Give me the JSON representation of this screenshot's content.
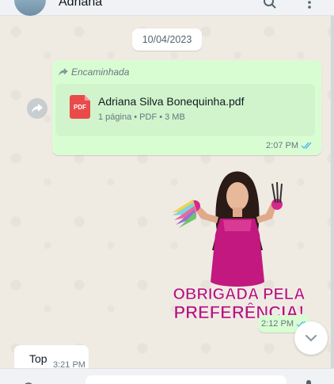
{
  "header": {
    "contact_name": "Adriana",
    "icons": [
      "search-icon",
      "menu-dots-icon"
    ]
  },
  "chat": {
    "date_chip": "10/04/2023",
    "outgoing_document": {
      "forwarded_label": "Encaminhada",
      "file_name": "Adriana Silva Bonequinha.pdf",
      "file_meta": "1 página • PDF • 3 MB",
      "file_type_badge": "PDF",
      "time": "2:07 PM",
      "status": "read"
    },
    "sticker": {
      "text_line1": "OBRIGADA PELA",
      "text_line2": "PREFERÊNCIA!",
      "time": "2:12 PM"
    },
    "incoming_message": {
      "text": "Top",
      "time": "3:21 PM"
    }
  },
  "colors": {
    "outgoing_bubble": "#d9fdd3",
    "chat_background": "#efeae2",
    "read_ticks": "#53bdeb",
    "pdf_red": "#e94b4b",
    "sticker_magenta": "#b5177d"
  }
}
